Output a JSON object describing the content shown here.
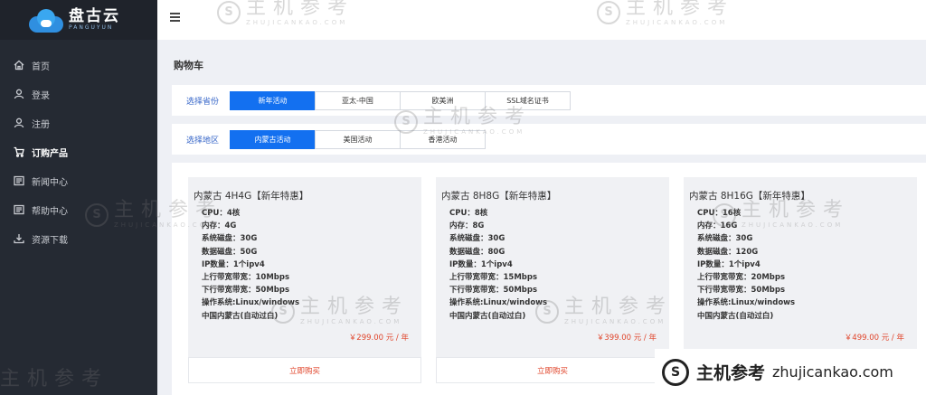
{
  "logo": {
    "name_cn": "盘古云",
    "name_en": "PANGUYUN"
  },
  "sidebar": {
    "items": [
      {
        "label": "首页",
        "icon": "home-icon"
      },
      {
        "label": "登录",
        "icon": "user-icon"
      },
      {
        "label": "注册",
        "icon": "user-icon"
      },
      {
        "label": "订购产品",
        "icon": "cart-icon",
        "active": true
      },
      {
        "label": "新闻中心",
        "icon": "news-icon"
      },
      {
        "label": "帮助中心",
        "icon": "help-icon"
      },
      {
        "label": "资源下载",
        "icon": "download-icon"
      }
    ]
  },
  "page": {
    "title": "购物车"
  },
  "filters": {
    "province": {
      "label": "选择省份",
      "options": [
        "新年活动",
        "亚太-中国",
        "欧美洲",
        "SSL域名证书"
      ],
      "selected": "新年活动"
    },
    "region": {
      "label": "选择地区",
      "options": [
        "内蒙古活动",
        "美国活动",
        "香港活动"
      ],
      "selected": "内蒙古活动"
    }
  },
  "products": [
    {
      "title": "内蒙古 4H4G【新年特惠】",
      "specs": [
        "CPU：4核",
        "内存：4G",
        "系统磁盘：30G",
        "数据磁盘：50G",
        "IP数量：1个ipv4",
        "上行带宽带宽：10Mbps",
        "下行带宽带宽：50Mbps",
        "操作系统:Linux/windows",
        "中国内蒙古(自动过白)"
      ],
      "price": "￥299.00 元 / 年",
      "buy_label": "立即购买"
    },
    {
      "title": "内蒙古 8H8G【新年特惠】",
      "specs": [
        "CPU：8核",
        "内存：8G",
        "系统磁盘：30G",
        "数据磁盘：80G",
        "IP数量：1个ipv4",
        "上行带宽带宽：15Mbps",
        "下行带宽带宽：50Mbps",
        "操作系统:Linux/windows",
        "中国内蒙古(自动过白)"
      ],
      "price": "￥399.00 元 / 年",
      "buy_label": "立即购买"
    },
    {
      "title": "内蒙古 8H16G【新年特惠】",
      "specs": [
        "CPU：16核",
        "内存：16G",
        "系统磁盘：30G",
        "数据磁盘：120G",
        "IP数量：1个ipv4",
        "上行带宽带宽：20Mbps",
        "下行带宽带宽：50Mbps",
        "操作系统:Linux/windows",
        "中国内蒙古(自动过白)"
      ],
      "price": "￥499.00 元 / 年",
      "buy_label": ""
    }
  ],
  "watermark": {
    "cn": "主机参考",
    "en": "ZHUJICANKAO.COM",
    "banner_cn": "主机参考",
    "banner_en": "zhujicankao.com"
  },
  "colors": {
    "accent": "#1370f0",
    "price": "#e0442a",
    "sidebar": "#252a33"
  }
}
